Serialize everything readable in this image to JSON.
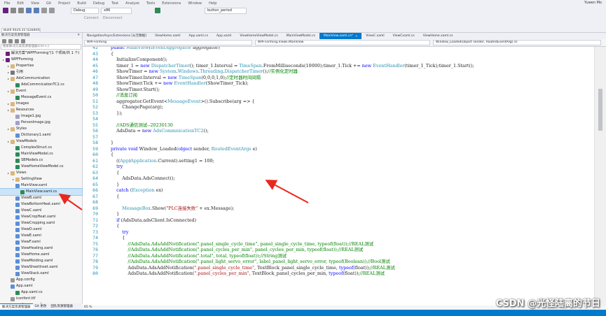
{
  "menu": {
    "items": [
      "File",
      "Edit",
      "View",
      "Git",
      "Project",
      "Build",
      "Debug",
      "Test",
      "Analyze",
      "Tools",
      "Extensions",
      "Window",
      "Help"
    ],
    "user": "Yuwen Mo"
  },
  "toolbar": {
    "config": "Debug",
    "platform": "x86",
    "target": "button_period"
  },
  "toolbar2": {
    "connect": "Connect",
    "disconnect": "Disconnect"
  },
  "build": {
    "label": "Build 4024.35 (Loaded)"
  },
  "solution_explorer": {
    "title": "解决方案资源管理器",
    "search_placeholder": "搜索解决方案资源管理器(Ctrl+;)",
    "items": [
      {
        "label": "解决方案\"WPFForming\"(1 个项目/共 1 个)",
        "icon": "solution-icon",
        "level": 0
      },
      {
        "label": "WPFForming",
        "icon": "project-icon",
        "level": 0
      },
      {
        "label": "Properties",
        "icon": "folder-icon",
        "level": 1
      },
      {
        "label": "引用",
        "icon": "references-icon",
        "level": 1
      },
      {
        "label": "AdsCommunication",
        "icon": "folder-icon",
        "level": 1
      },
      {
        "label": "AdsCommnicationTC2.cs",
        "icon": "cs-file-icon",
        "level": 2
      },
      {
        "label": "Event",
        "icon": "folder-icon",
        "level": 1
      },
      {
        "label": "MessageEvent.cs",
        "icon": "cs-file-icon",
        "level": 2
      },
      {
        "label": "Images",
        "icon": "folder-icon",
        "level": 1
      },
      {
        "label": "Resources",
        "icon": "folder-icon",
        "level": 1
      },
      {
        "label": "Image1.jpg",
        "icon": "image-file-icon",
        "level": 2
      },
      {
        "label": "PersonImage.jpg",
        "icon": "image-file-icon",
        "level": 2
      },
      {
        "label": "Styles",
        "icon": "folder-icon",
        "level": 1
      },
      {
        "label": "Dictionary1.xaml",
        "icon": "xaml-file-icon",
        "level": 2
      },
      {
        "label": "ViewModels",
        "icon": "folder-icon",
        "level": 1
      },
      {
        "label": "ComplexStruct.cs",
        "icon": "cs-file-icon",
        "level": 2
      },
      {
        "label": "MainViewModel.cs",
        "icon": "cs-file-icon",
        "level": 2
      },
      {
        "label": "SBModels.cs",
        "icon": "cs-file-icon",
        "level": 2
      },
      {
        "label": "ViewHomeViewModel.cs",
        "icon": "cs-file-icon",
        "level": 2
      },
      {
        "label": "Views",
        "icon": "folder-icon",
        "level": 1
      },
      {
        "label": "SettingView",
        "icon": "folder-icon",
        "level": 2
      },
      {
        "label": "MainView.xaml",
        "icon": "xaml-file-icon",
        "level": 2
      },
      {
        "label": "MainView.xaml.cs",
        "icon": "cs-file-icon",
        "level": 3,
        "selected": true
      },
      {
        "label": "ViewB.xaml",
        "icon": "xaml-file-icon",
        "level": 2
      },
      {
        "label": "ViewBottomHeat.xaml",
        "icon": "xaml-file-icon",
        "level": 2
      },
      {
        "label": "ViewC.xaml",
        "icon": "xaml-file-icon",
        "level": 2
      },
      {
        "label": "ViewCropHeat.xaml",
        "icon": "xaml-file-icon",
        "level": 2
      },
      {
        "label": "ViewCropping.xaml",
        "icon": "xaml-file-icon",
        "level": 2
      },
      {
        "label": "ViewD.xaml",
        "icon": "xaml-file-icon",
        "level": 2
      },
      {
        "label": "ViewE.xaml",
        "icon": "xaml-file-icon",
        "level": 2
      },
      {
        "label": "ViewF.xaml",
        "icon": "xaml-file-icon",
        "level": 2
      },
      {
        "label": "ViewHeating.xaml",
        "icon": "xaml-file-icon",
        "level": 2
      },
      {
        "label": "ViewHome.xaml",
        "icon": "xaml-file-icon",
        "level": 2
      },
      {
        "label": "ViewMolding.xaml",
        "icon": "xaml-file-icon",
        "level": 2
      },
      {
        "label": "ViewSheetInset.xaml",
        "icon": "xaml-file-icon",
        "level": 2
      },
      {
        "label": "ViewStack.xaml",
        "icon": "xaml-file-icon",
        "level": 2
      },
      {
        "label": "App.config",
        "icon": "config-file-icon",
        "level": 1
      },
      {
        "label": "App.xaml",
        "icon": "xaml-file-icon",
        "level": 1
      },
      {
        "label": "App.xaml.cs",
        "icon": "cs-file-icon",
        "level": 2
      },
      {
        "label": "iconfont.ttf",
        "icon": "config-file-icon",
        "level": 1
      },
      {
        "label": "packages.config",
        "icon": "config-file-icon",
        "level": 1
      }
    ],
    "bottom_tabs": [
      "解决方案资源管理器",
      "Git 更改",
      "团队资源管理器"
    ]
  },
  "doc_tabs": [
    "NavigationAsyncExtensions [从元数据]",
    "ViewHome.xaml",
    "App.xaml.cs",
    "App.xaml",
    "ViewHomeViewModel.cs",
    "MainViewModel.cs",
    "MainView.xaml.cs*",
    "ViewC.xaml",
    "ViewCxaml.cs",
    "ViewHome.xaml.cs"
  ],
  "active_doc_tab": 6,
  "nav": {
    "project": "WPFForming",
    "class": "WPFForming.Views.MainView",
    "member": "Window_Loaded(object sender, RoutedEventArgs e)"
  },
  "status": {
    "zoom": "65 %"
  },
  "code_lines": [
    {
      "n": "42",
      "t": "public MainView(IEventAggregator aggregator)"
    },
    {
      "n": "43",
      "t": "{"
    },
    {
      "n": "44",
      "t": "    InitializeComponent();"
    },
    {
      "n": "45",
      "t": "    timer_1 = new DispatcherTimer(); timer_1.Interval = TimeSpan.FromMilliseconds(10000);timer_1.Tick += new EventHandler(timer_1_Tick);timer_1.Start();"
    },
    {
      "n": "46",
      "t": "    ShowTimer = new System.Windows.Threading.DispatcherTimer();//实例化定时器"
    },
    {
      "n": "47",
      "t": "    ShowTimer.Interval = new TimeSpan(0,0,0,1,0);//定时器时间间隔"
    },
    {
      "n": "48",
      "t": "    ShowTimer.Tick += new EventHandler(ShowTimer_Tick);"
    },
    {
      "n": "49",
      "t": "    ShowTimer.Start();"
    },
    {
      "n": "50",
      "t": "    //消息订阅"
    },
    {
      "n": "51",
      "t": "    aggregator.GetEvent<MessageEvent>().Subscribe(arg => {"
    },
    {
      "n": "52",
      "t": "        ChangePage(arg);"
    },
    {
      "n": "53",
      "t": "    });"
    },
    {
      "n": "54",
      "t": ""
    },
    {
      "n": "55",
      "t": "    //ADS通信测试--20230130"
    },
    {
      "n": "56",
      "t": "    AdsData = new AdsCommnicationTC2();"
    },
    {
      "n": "57",
      "t": ""
    },
    {
      "n": "58",
      "t": "}"
    },
    {
      "n": "59",
      "t": "private void Window_Loaded(object sender, RoutedEventArgs e)"
    },
    {
      "n": "60",
      "t": "{"
    },
    {
      "n": "61",
      "t": "    ((App)Application.Current).setting1 = 100;"
    },
    {
      "n": "62",
      "t": "    try"
    },
    {
      "n": "63",
      "t": "    {"
    },
    {
      "n": "64",
      "t": "        AdsData.AdsConnect();"
    },
    {
      "n": "65",
      "t": "    }"
    },
    {
      "n": "66",
      "t": "    catch (Exception ex)"
    },
    {
      "n": "67",
      "t": "    {"
    },
    {
      "n": "68",
      "t": ""
    },
    {
      "n": "69",
      "t": "        MessageBox.Show(\"PLC连接失败\" + ex.Message);"
    },
    {
      "n": "70",
      "t": "    }"
    },
    {
      "n": "71",
      "t": "    if (AdsData.adsClient.IsConnected)"
    },
    {
      "n": "72",
      "t": "    {"
    },
    {
      "n": "73",
      "t": "        try"
    },
    {
      "n": "74",
      "t": "        {"
    },
    {
      "n": "75",
      "t": "            //AdsData.AdsAddNotification(\".panel_single_cycle_time\", panel_single_cycle_time, typeof(float));//REAL测试"
    },
    {
      "n": "76",
      "t": "            //AdsData.AdsAddNotification(\".panel_cycles_per_min\", panel_cycles_per_min, typeof(float));//REAL测试"
    },
    {
      "n": "77",
      "t": "            //AdsData.AdsAddNotification(\".total\", total, typeof(float));//String测试"
    },
    {
      "n": "78",
      "t": "            //AdsData.AdsAddNotification(\".panel_light_servo_error\", label_panel_light_servo_error, typeof(Boolean));//Bool测试"
    },
    {
      "n": "79",
      "t": "            AdsData.AdsAddNotification(\".panel_single_cycle_time\", TextBlock_panel_single_cycle_time, typeof(float));//REAL测试"
    },
    {
      "n": "80",
      "t": "            AdsData.AdsAddNotification(\".panel_cycles_per_min\", TextBlock_panel_cycles_per_min, typeof(float));//REAL测试"
    }
  ],
  "watermark": "CSDN @光怪陆离的节日",
  "colors": {
    "accent": "#007acc",
    "keyword": "#0000ff",
    "type": "#2b91af",
    "string": "#a31515",
    "comment": "#008000",
    "arrow": "#e8281e"
  }
}
